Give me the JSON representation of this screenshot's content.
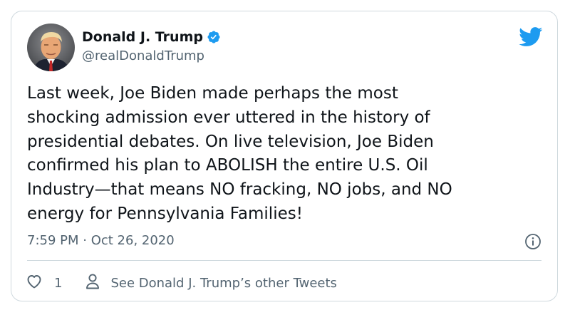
{
  "tweet": {
    "author": {
      "display_name": "Donald J. Trump",
      "handle": "@realDonaldTrump",
      "verified": true
    },
    "text": "Last week, Joe Biden made perhaps the most\nshocking admission ever uttered in the history of\npresidential debates. On live television, Joe Biden\nconfirmed his plan to ABOLISH the entire U.S. Oil\nIndustry—that means NO fracking, NO jobs, and NO\nenergy for Pennsylvania Families!",
    "timestamp": "7:59 PM · Oct 26, 2020",
    "like_count": "1",
    "other_tweets_label": "See Donald J. Trump’s other Tweets"
  },
  "icons": {
    "brand": "twitter-bird-icon",
    "verified": "verified-badge-icon",
    "info": "info-icon",
    "like": "heart-icon",
    "profile": "person-icon"
  },
  "colors": {
    "twitter_blue": "#1d9bf0",
    "text_primary": "#0f1419",
    "text_secondary": "#536471",
    "border": "#cfd9de"
  }
}
